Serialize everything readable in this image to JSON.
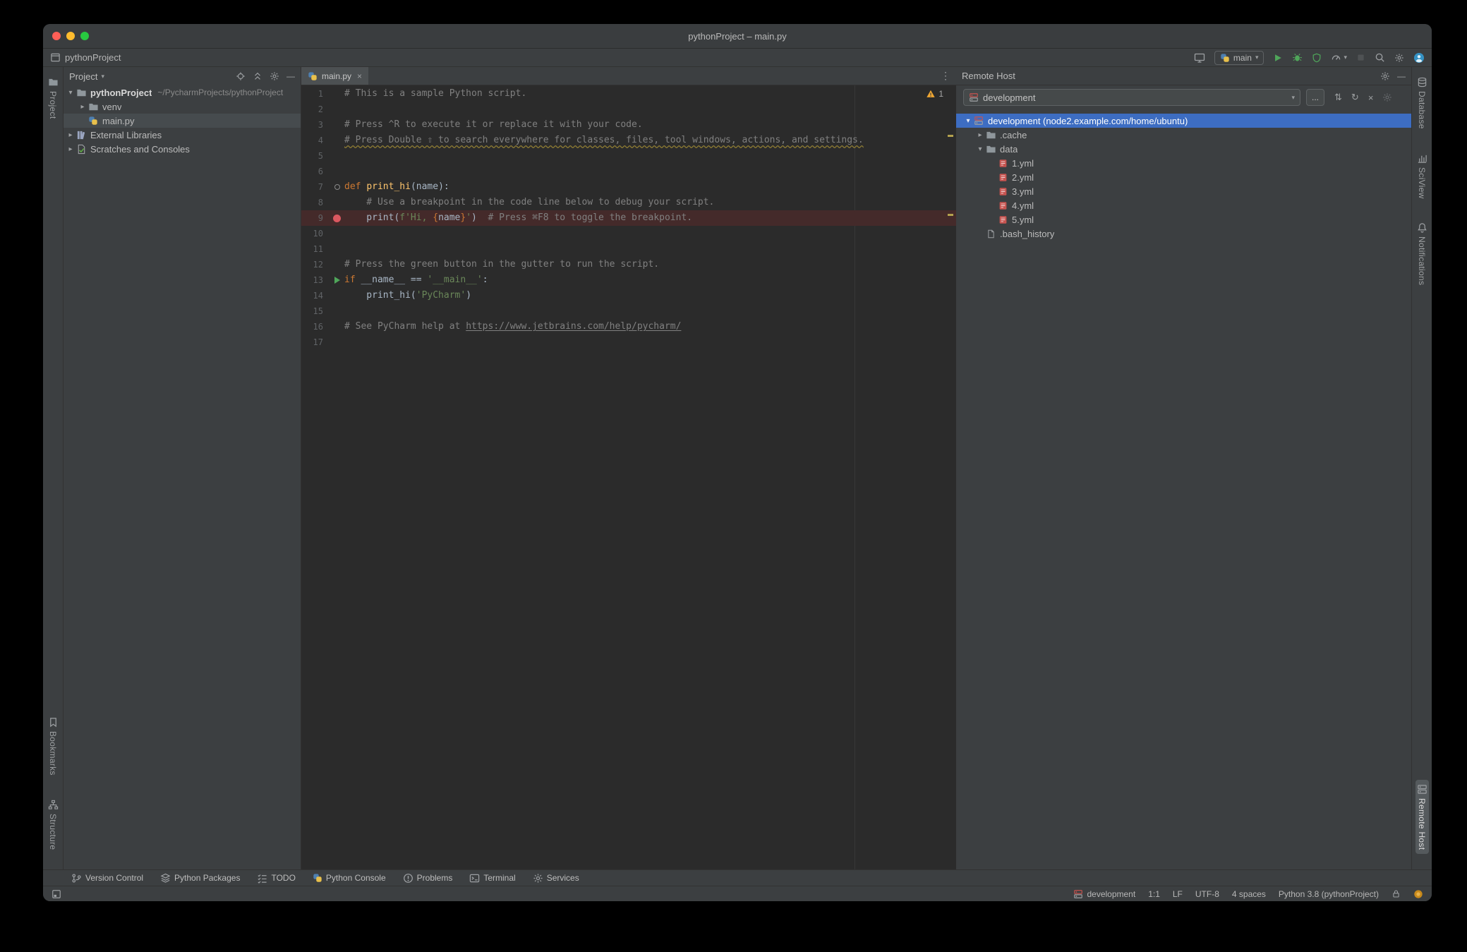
{
  "titlebar": {
    "title": "pythonProject – main.py"
  },
  "toolbar": {
    "project": "pythonProject",
    "run_config": "main",
    "right_buttons": [
      {
        "name": "screen-share-button",
        "icon": "monitor"
      },
      {
        "name": "run-config-select",
        "type": "combo",
        "icon": "python-file"
      },
      {
        "name": "run-button",
        "icon": "play"
      },
      {
        "name": "debug-button",
        "icon": "bug"
      },
      {
        "name": "coverage-button",
        "icon": "shield"
      },
      {
        "name": "profiler-button",
        "icon": "gauge",
        "caret": true
      },
      {
        "name": "stop-button",
        "icon": "stop",
        "disabled": true
      },
      {
        "name": "search-everywhere-button",
        "icon": "search"
      },
      {
        "name": "settings-button",
        "icon": "gear"
      },
      {
        "name": "avatar",
        "icon": "avatar"
      }
    ]
  },
  "left_stripe": {
    "top": [
      {
        "label": "Project",
        "icon": "folder",
        "active": false
      }
    ],
    "bottom": [
      {
        "label": "Bookmarks",
        "icon": "bookmark"
      },
      {
        "label": "Structure",
        "icon": "structure"
      }
    ]
  },
  "right_stripe": {
    "top": [
      {
        "label": "Database",
        "icon": "database"
      },
      {
        "label": "SciView",
        "icon": "sciview"
      },
      {
        "label": "Notifications",
        "icon": "bell"
      }
    ],
    "bottom": [
      {
        "label": "Remote Host",
        "icon": "remote-host",
        "active": true
      }
    ]
  },
  "project_panel": {
    "title": "Project",
    "tree": [
      {
        "label": "pythonProject",
        "hint": "~/PycharmProjects/pythonProject",
        "icon": "folder",
        "depth": 0,
        "chevron": "down",
        "bold": true
      },
      {
        "label": "venv",
        "icon": "folder",
        "depth": 1,
        "chevron": "right"
      },
      {
        "label": "main.py",
        "icon": "python-file",
        "depth": 1,
        "chevron": "none",
        "selected": "gray"
      },
      {
        "label": "External Libraries",
        "icon": "library",
        "depth": 0,
        "chevron": "right"
      },
      {
        "label": "Scratches and Consoles",
        "icon": "scratch",
        "depth": 0,
        "chevron": "right"
      }
    ]
  },
  "editor": {
    "tab": {
      "label": "main.py",
      "icon": "python-file"
    },
    "inspection": {
      "warning_count": "1"
    },
    "lines": [
      {
        "n": 1,
        "segs": [
          [
            "# This is a sample Python script.",
            "com"
          ]
        ]
      },
      {
        "n": 2,
        "segs": []
      },
      {
        "n": 3,
        "segs": [
          [
            "# Press ^R to execute it or replace it with your code.",
            "com"
          ]
        ]
      },
      {
        "n": 4,
        "segs": [
          [
            "# Press Double ⇧ to search everywhere for classes, files, tool windows, actions, and settings.",
            "com typo"
          ]
        ]
      },
      {
        "n": 5,
        "segs": []
      },
      {
        "n": 6,
        "segs": []
      },
      {
        "n": 7,
        "segs": [
          [
            "def ",
            "kw"
          ],
          [
            "print_hi",
            "fn"
          ],
          [
            "(name):",
            "txt"
          ]
        ],
        "ring": true
      },
      {
        "n": 8,
        "segs": [
          [
            "    # Use a breakpoint in the code line below to debug your script.",
            "com"
          ]
        ]
      },
      {
        "n": 9,
        "segs": [
          [
            "    print(",
            "txt"
          ],
          [
            "f'Hi, ",
            "str"
          ],
          [
            "{",
            "brace"
          ],
          [
            "name",
            "txt"
          ],
          [
            "}",
            "brace"
          ],
          [
            "'",
            "str"
          ],
          [
            ")",
            "txt"
          ],
          [
            "  # Press ⌘F8 to toggle the breakpoint.",
            "com"
          ]
        ],
        "breakpoint": true
      },
      {
        "n": 10,
        "segs": []
      },
      {
        "n": 11,
        "segs": []
      },
      {
        "n": 12,
        "segs": [
          [
            "# Press the green button in the gutter to run the script.",
            "com"
          ]
        ]
      },
      {
        "n": 13,
        "segs": [
          [
            "if ",
            "kw"
          ],
          [
            "__name__",
            "txt"
          ],
          [
            " == ",
            "txt"
          ],
          [
            "'__main__'",
            "str"
          ],
          [
            ":",
            "txt"
          ]
        ],
        "run": true
      },
      {
        "n": 14,
        "segs": [
          [
            "    print_hi(",
            "txt"
          ],
          [
            "'PyCharm'",
            "str"
          ],
          [
            ")",
            "txt"
          ]
        ]
      },
      {
        "n": 15,
        "segs": []
      },
      {
        "n": 16,
        "segs": [
          [
            "# See PyCharm help at ",
            "com"
          ],
          [
            "https://www.jetbrains.com/help/pycharm/",
            "com link"
          ]
        ]
      },
      {
        "n": 17,
        "segs": []
      }
    ]
  },
  "remote_host": {
    "title": "Remote Host",
    "combo": "development",
    "browse": "...",
    "tree": [
      {
        "label": "development (node2.example.com/home/ubuntu)",
        "icon": "server",
        "depth": 0,
        "chevron": "down",
        "selected": "blue"
      },
      {
        "label": ".cache",
        "icon": "folder",
        "depth": 1,
        "chevron": "right"
      },
      {
        "label": "data",
        "icon": "folder",
        "depth": 1,
        "chevron": "down"
      },
      {
        "label": "1.yml",
        "icon": "yml-file",
        "depth": 2,
        "chevron": "none"
      },
      {
        "label": "2.yml",
        "icon": "yml-file",
        "depth": 2,
        "chevron": "none"
      },
      {
        "label": "3.yml",
        "icon": "yml-file",
        "depth": 2,
        "chevron": "none"
      },
      {
        "label": "4.yml",
        "icon": "yml-file",
        "depth": 2,
        "chevron": "none"
      },
      {
        "label": "5.yml",
        "icon": "yml-file",
        "depth": 2,
        "chevron": "none"
      },
      {
        "label": ".bash_history",
        "icon": "file",
        "depth": 1,
        "chevron": "none"
      }
    ]
  },
  "bottom_bar": {
    "items": [
      {
        "label": "Version Control",
        "icon": "branch"
      },
      {
        "label": "Python Packages",
        "icon": "packages"
      },
      {
        "label": "TODO",
        "icon": "todo"
      },
      {
        "label": "Python Console",
        "icon": "python-file"
      },
      {
        "label": "Problems",
        "icon": "problems"
      },
      {
        "label": "Terminal",
        "icon": "terminal"
      },
      {
        "label": "Services",
        "icon": "services"
      }
    ]
  },
  "status_bar": {
    "items": [
      {
        "label": "development",
        "icon": "server",
        "name": "status-remote-interpreter"
      },
      {
        "label": "1:1",
        "name": "status-caret-position"
      },
      {
        "label": "LF",
        "name": "status-line-separator"
      },
      {
        "label": "UTF-8",
        "name": "status-encoding"
      },
      {
        "label": "4 spaces",
        "name": "status-indent"
      },
      {
        "label": "Python 3.8 (pythonProject)",
        "name": "status-interpreter"
      },
      {
        "icon": "lock",
        "name": "lock-icon"
      },
      {
        "icon": "dot-amber",
        "name": "update-indicator-icon"
      }
    ]
  },
  "colors": {
    "selection_blue": "#3d6dc2",
    "run_green": "#4fa65a",
    "breakpoint_red": "#db5860",
    "warning_yellow": "#f0a732",
    "editor_bg": "#2b2b2b",
    "panel_bg": "#3c3f41"
  }
}
